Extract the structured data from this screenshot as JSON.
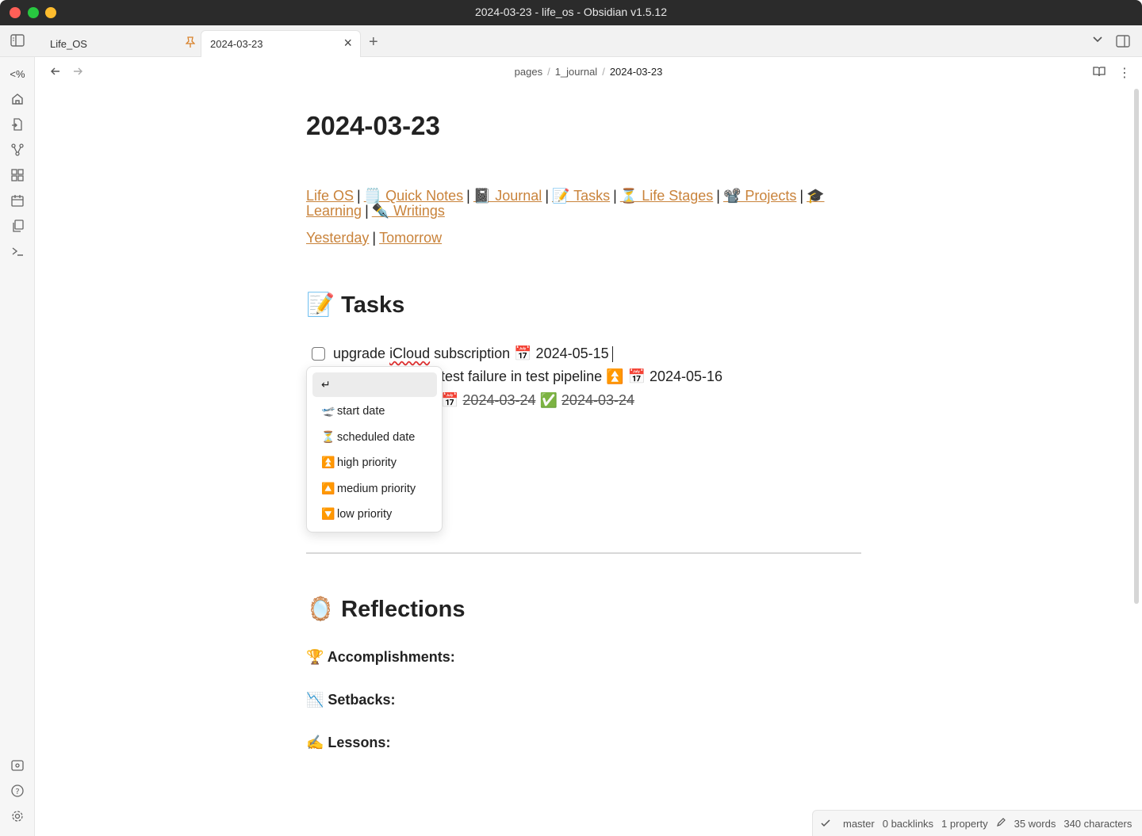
{
  "window": {
    "title": "2024-03-23 - life_os - Obsidian v1.5.12"
  },
  "tabs": [
    {
      "label": "Life_OS",
      "pinned": true
    },
    {
      "label": "2024-03-23",
      "active": true
    }
  ],
  "breadcrumb": {
    "items": [
      "pages",
      "1_journal",
      "2024-03-23"
    ]
  },
  "ribbon": {
    "top": [
      "templater-icon",
      "home-icon",
      "file-import-icon",
      "graph-icon",
      "dashboard-icon",
      "calendar-icon",
      "copy-icon",
      "terminal-icon"
    ],
    "bottom": [
      "vault-icon",
      "help-icon",
      "settings-icon"
    ],
    "templater_glyph": "<%"
  },
  "note": {
    "title": "2024-03-23",
    "nav_links": [
      "Life OS",
      "🗒️ Quick Notes",
      "📓 Journal",
      "📝 Tasks",
      "⏳ Life Stages",
      "📽️ Projects",
      "🎓 Learning",
      "✒️ Writings"
    ],
    "day_links": [
      "Yesterday",
      "Tomorrow"
    ],
    "tasks_heading": "📝 Tasks",
    "task1": {
      "prefix": "upgrade ",
      "misspelled": "iCloud",
      "suffix": " subscription 📅 2024-05-15"
    },
    "task2": {
      "visible_text": "test failure in test pipeline ⏫ 📅 2024-05-16"
    },
    "task3": {
      "visible_text_a": "📅 ",
      "visible_struck": "2024-03-24",
      "check": " ✅ ",
      "visible_struck2": "2024-03-24"
    },
    "reflections_heading": "🪞 Reflections",
    "accomplishments": "🏆 Accomplishments:",
    "setbacks": "📉 Setbacks:",
    "lessons": "✍️ Lessons:"
  },
  "suggest_popup": {
    "items": [
      {
        "emoji": "↵",
        "label": ""
      },
      {
        "emoji": "🛫",
        "label": "start date"
      },
      {
        "emoji": "⏳",
        "label": "scheduled date"
      },
      {
        "emoji": "⏫",
        "label": "high priority"
      },
      {
        "emoji": "🔼",
        "label": "medium priority"
      },
      {
        "emoji": "🔽",
        "label": "low priority"
      }
    ]
  },
  "status_bar": {
    "branch": "master",
    "backlinks": "0 backlinks",
    "properties": "1 property",
    "words": "35 words",
    "characters": "340 characters"
  },
  "colors": {
    "link": "#c9833b",
    "titlebar": "#2b2b2b",
    "ribbon": "#f6f6f6"
  }
}
